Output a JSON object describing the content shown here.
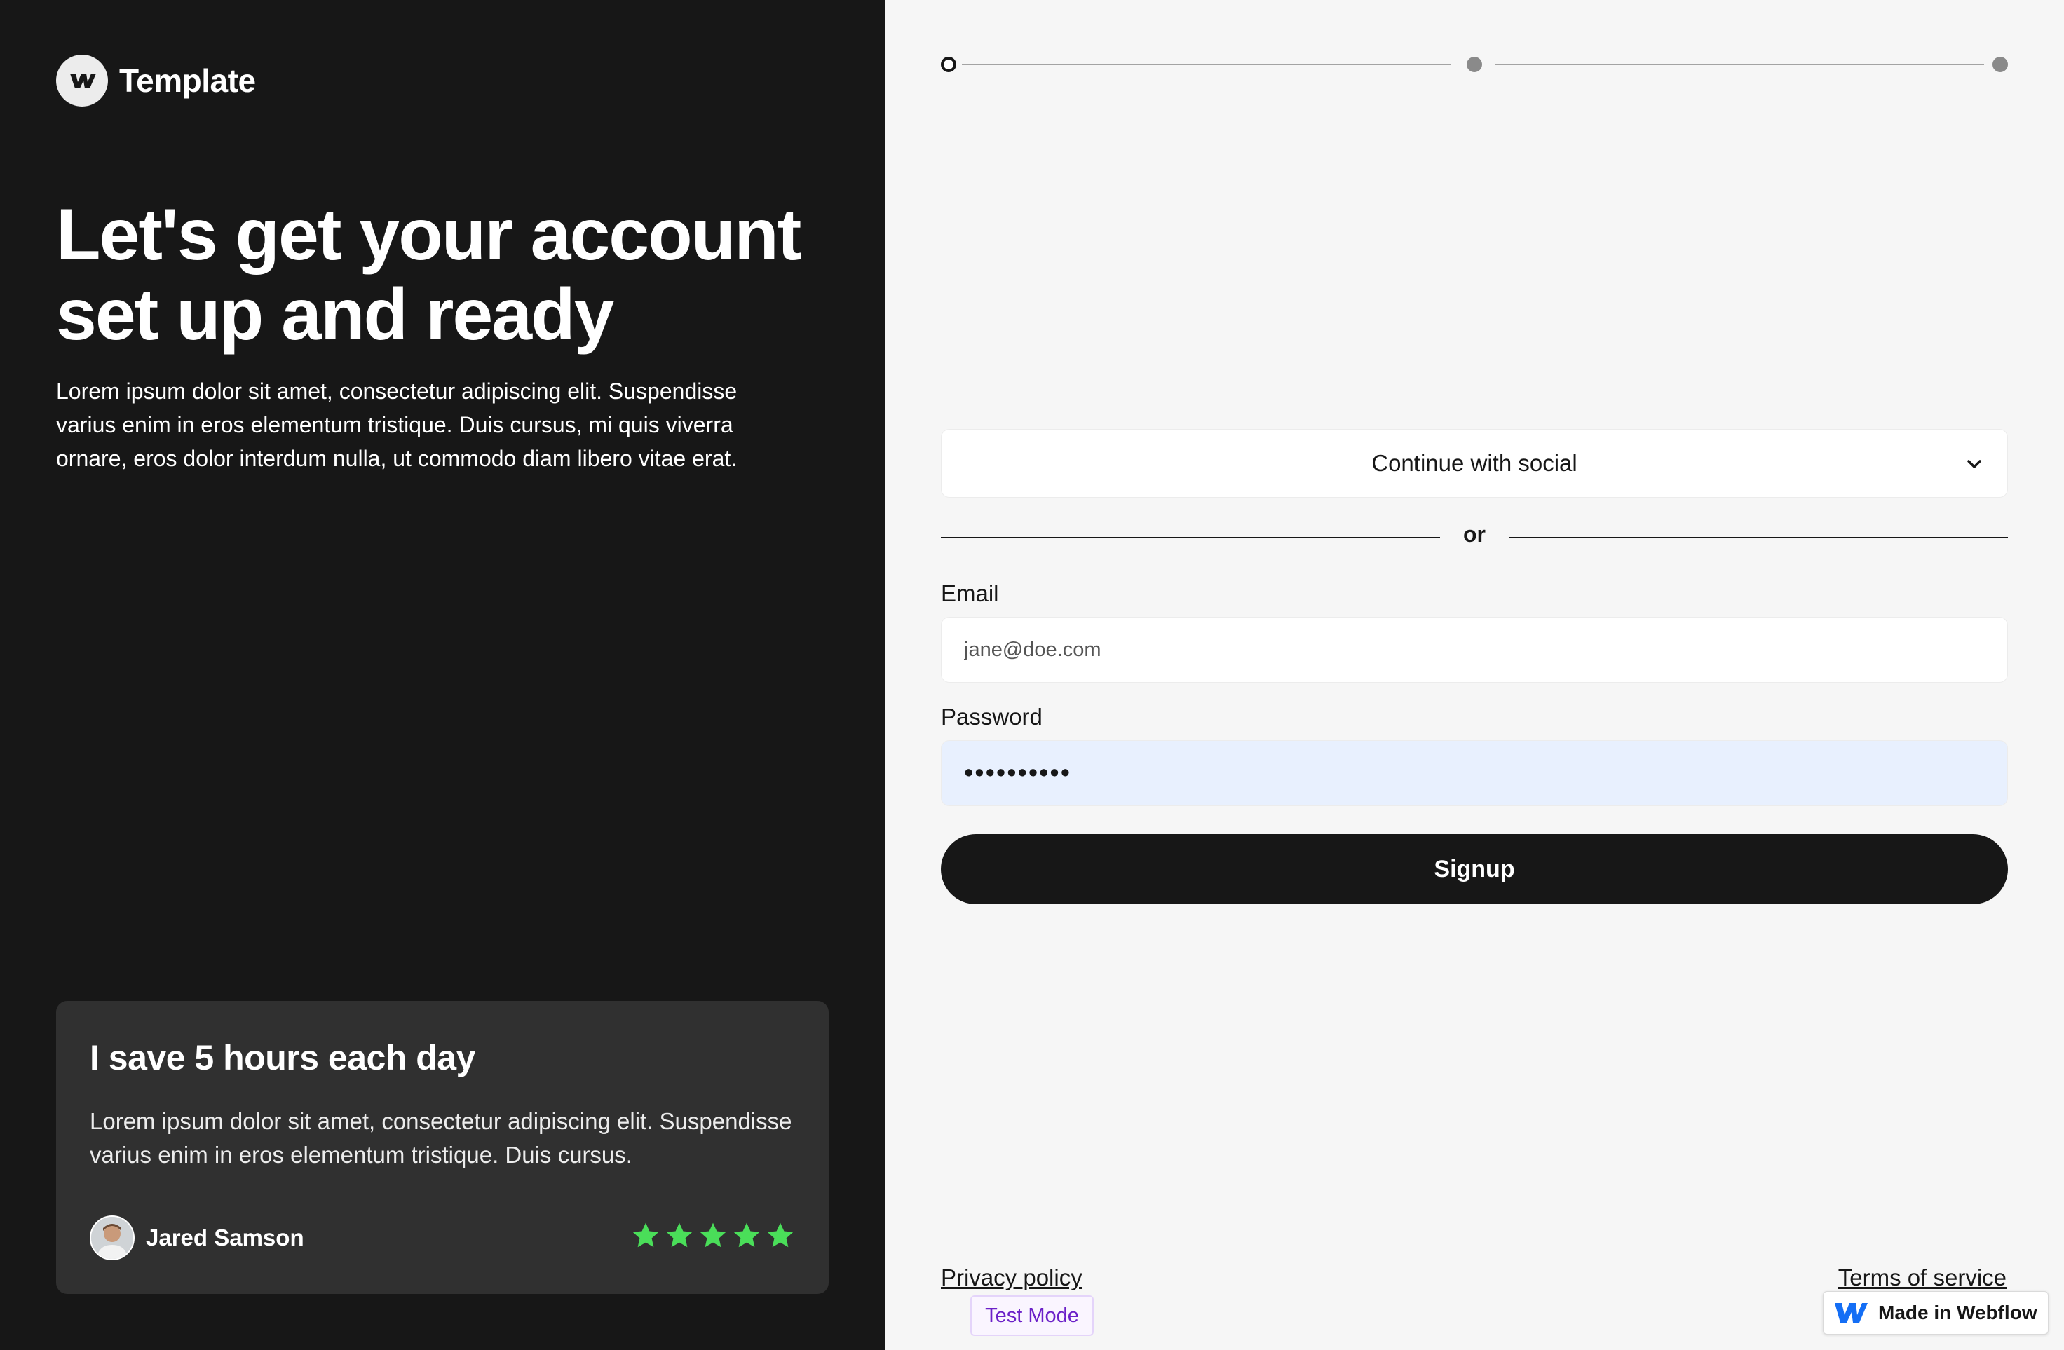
{
  "brand": {
    "name": "Template",
    "logo_icon": "webflow-w-icon"
  },
  "hero": {
    "title": "Let's get your account set up and ready",
    "text": "Lorem ipsum dolor sit amet, consectetur adipiscing elit. Suspendisse varius enim in eros elementum tristique. Duis cursus, mi quis viverra ornare, eros dolor interdum nulla, ut commodo diam libero vitae erat."
  },
  "testimonial": {
    "title": "I save 5 hours each day",
    "text": "Lorem ipsum dolor sit amet, consectetur adipiscing elit. Suspendisse varius enim in eros elementum tristique. Duis cursus.",
    "author": "Jared Samson",
    "rating": 5,
    "star_color": "#4ade59"
  },
  "progress": {
    "steps": 3,
    "current": 1
  },
  "form": {
    "social_label": "Continue with social",
    "divider_text": "or",
    "email_label": "Email",
    "email_value": "jane@doe.com",
    "password_label": "Password",
    "password_value": "••••••••••",
    "submit_label": "Signup"
  },
  "footer": {
    "privacy": "Privacy policy",
    "terms": "Terms of service",
    "test_mode": "Test Mode",
    "webflow_badge": "Made in Webflow"
  },
  "colors": {
    "dark": "#171717",
    "card": "#303030",
    "right_bg": "#f6f6f6",
    "autofill": "#e8f0fe",
    "test_mode_text": "#6b21c8",
    "webflow_blue": "#146ef5"
  }
}
